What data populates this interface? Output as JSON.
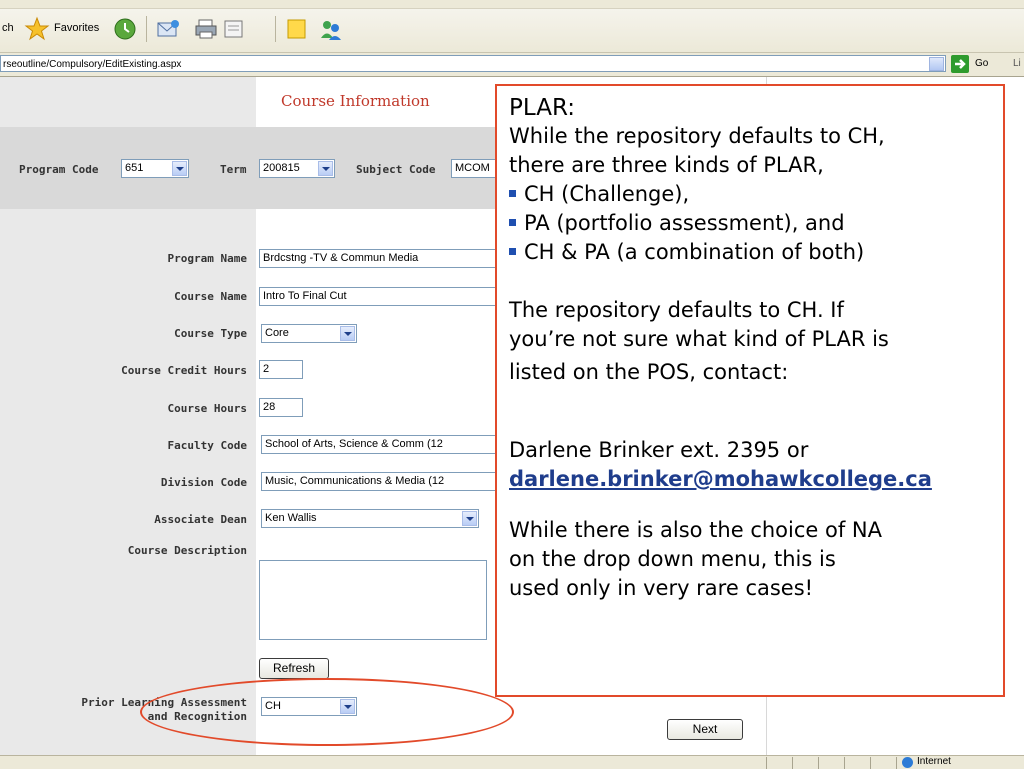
{
  "browser": {
    "toolbar": {
      "search_fragment": "ch",
      "favorites_label": "Favorites"
    },
    "address": {
      "url": "rseoutline/Compulsory/EditExisting.aspx",
      "go_label": "Go",
      "links_label": "Li"
    },
    "status": {
      "zone": "Internet"
    }
  },
  "page": {
    "title": "Course Information",
    "filters": {
      "program_code_label": "Program Code",
      "program_code_value": "651",
      "term_label": "Term",
      "term_value": "200815",
      "subject_code_label": "Subject Code",
      "subject_code_value": "MCOM"
    },
    "fields": {
      "program_name_label": "Program Name",
      "program_name_value": "Brdcstng -TV & Commun  Media",
      "course_name_label": "Course Name",
      "course_name_value": "Intro To Final Cut",
      "course_type_label": "Course Type",
      "course_type_value": "Core",
      "credit_hours_label": "Course Credit Hours",
      "credit_hours_value": "2",
      "course_hours_label": "Course Hours",
      "course_hours_value": "28",
      "faculty_code_label": "Faculty Code",
      "faculty_code_value": "School of Arts, Science & Comm (12",
      "division_code_label": "Division Code",
      "division_code_value": "Music, Communications & Media (12",
      "associate_dean_label": "Associate Dean",
      "associate_dean_value": "Ken Wallis",
      "course_description_label": "Course Description",
      "plar_label_line1": "Prior Learning Assessment",
      "plar_label_line2": "and Recognition",
      "plar_value": "CH"
    },
    "buttons": {
      "refresh": "Refresh",
      "next": "Next"
    }
  },
  "callout": {
    "heading": "PLAR:",
    "intro_line1": "While the repository defaults to CH,",
    "intro_line2": "there are three kinds of PLAR,",
    "bullets": [
      "CH (Challenge),",
      "PA (portfolio assessment), and",
      "CH & PA (a combination of both)"
    ],
    "default_line1": "The repository defaults to CH. If",
    "default_line2": "you’re not sure what kind of PLAR is",
    "default_line3": "listed on the POS, contact:",
    "contact_name": "Darlene Brinker ext. 2395 or",
    "contact_email": "darlene.brinker@mohawkcollege.ca",
    "note_line1": "While there is also the choice of NA",
    "note_line2": "on the drop down menu, this is",
    "note_line3": "used only in very rare cases!",
    "accent_color": "#e24a2a"
  }
}
